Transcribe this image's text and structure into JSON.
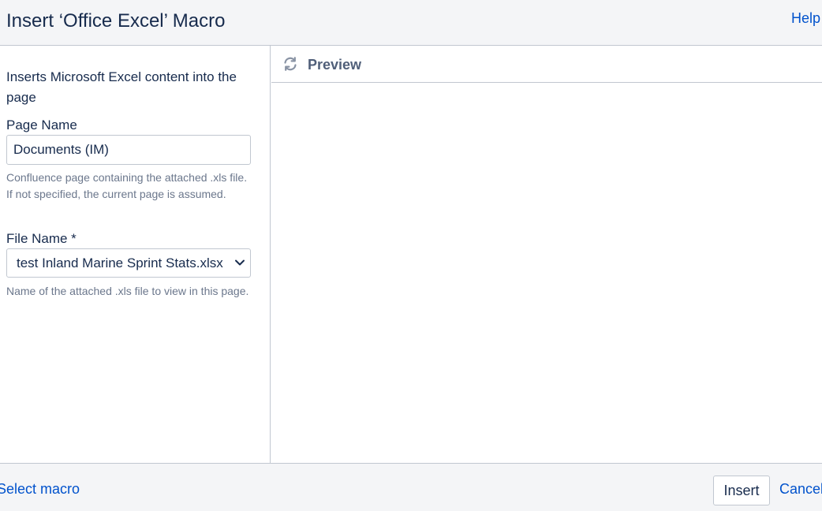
{
  "dialog": {
    "title": "Insert ‘Office Excel’ Macro",
    "help_label": "Help"
  },
  "form": {
    "description": "Inserts Microsoft Excel content into the page",
    "page_name": {
      "label": "Page Name",
      "value": "Documents (IM)",
      "help": "Confluence page containing the attached .xls file. If not specified, the current page is assumed."
    },
    "file_name": {
      "label": "File Name *",
      "selected": "test Inland Marine Sprint Stats.xlsx",
      "help": "Name of the attached .xls file to view in this page."
    }
  },
  "preview": {
    "title": "Preview",
    "refresh_icon": "refresh-icon"
  },
  "footer": {
    "select_macro_label": "Select macro",
    "insert_label": "Insert",
    "cancel_label": "Cancel"
  },
  "colors": {
    "link": "#0052cc",
    "header_bg": "#f4f5f7",
    "border": "#c1c7d0",
    "help_text": "#6b778c"
  }
}
